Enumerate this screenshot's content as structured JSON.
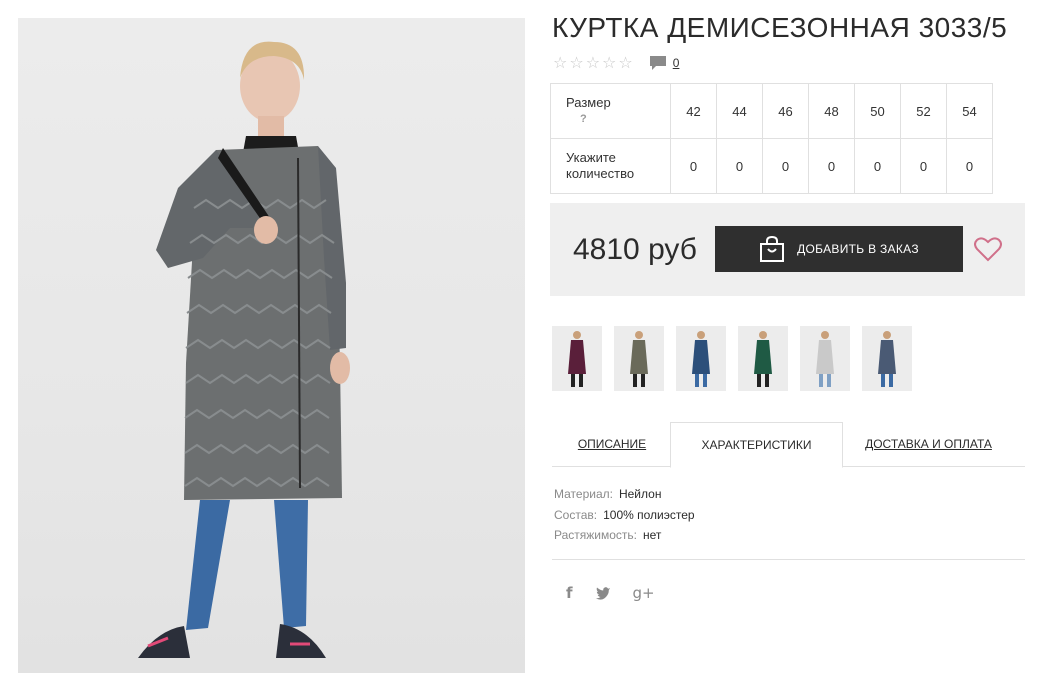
{
  "product": {
    "title": "КУРТКА ДЕМИСЕЗОННАЯ 3033/5",
    "review_count": "0",
    "stars": [
      "☆",
      "☆",
      "☆",
      "☆",
      "☆"
    ]
  },
  "sizes": {
    "size_label": "Размер",
    "help_mark": "?",
    "qty_label_1": "Укажите",
    "qty_label_2": "количество",
    "values": [
      "42",
      "44",
      "46",
      "48",
      "50",
      "52",
      "54"
    ],
    "quantities": [
      "0",
      "0",
      "0",
      "0",
      "0",
      "0",
      "0"
    ]
  },
  "order": {
    "price": "4810 руб",
    "add_label": "ДОБАВИТЬ В ЗАКАЗ"
  },
  "tabs": {
    "description": "ОПИСАНИЕ",
    "specs": "ХАРАКТЕРИСТИКИ",
    "delivery": "ДОСТАВКА И ОПЛАТА"
  },
  "properties": [
    {
      "key": "Материал:",
      "value": "Нейлон"
    },
    {
      "key": "Состав:",
      "value": "100% полиэстер"
    },
    {
      "key": "Растяжимость:",
      "value": "нет"
    }
  ],
  "social": {
    "facebook": "f",
    "twitter": "🐦",
    "google": "g+"
  },
  "colors": {
    "thumb_coats": [
      "#5a1f3a",
      "#6a6a5a",
      "#2c4f7a",
      "#1f5a44",
      "#c9c9c9",
      "#4a5a74"
    ],
    "main_coat": "#6c6f70",
    "button": "#2f2f2f",
    "heart": "#d0708a"
  }
}
